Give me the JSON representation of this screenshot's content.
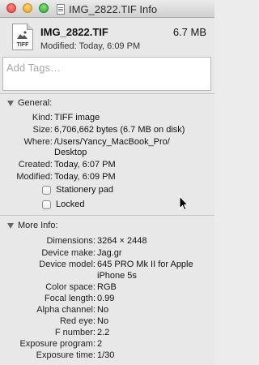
{
  "window": {
    "title": "IMG_2822.TIF Info"
  },
  "header": {
    "filename": "IMG_2822.TIF",
    "size": "6.7 MB",
    "modified": "Modified: Today, 6:09 PM",
    "file_icon_ext": "TIFF"
  },
  "tags": {
    "placeholder": "Add Tags…"
  },
  "general": {
    "title": "General:",
    "rows": [
      {
        "k": "Kind:",
        "v": "TIFF image"
      },
      {
        "k": "Size:",
        "v": "6,706,662 bytes (6.7 MB on disk)"
      },
      {
        "k": "Where:",
        "v": "/Users/Yancy_MacBook_Pro/"
      },
      {
        "k": "",
        "v": "Desktop"
      },
      {
        "k": "Created:",
        "v": "Today, 6:07 PM"
      },
      {
        "k": "Modified:",
        "v": "Today, 6:09 PM"
      }
    ],
    "stationery_label": "Stationery pad",
    "locked_label": "Locked",
    "stationery_checked": false,
    "locked_checked": false
  },
  "more_info": {
    "title": "More Info:",
    "rows": [
      {
        "k": "Dimensions:",
        "v": "3264 × 2448"
      },
      {
        "k": "Device make:",
        "v": "Jag.gr"
      },
      {
        "k": "Device model:",
        "v": "645 PRO Mk II for Apple"
      },
      {
        "k": "",
        "v": "iPhone 5s"
      },
      {
        "k": "Color space:",
        "v": "RGB"
      },
      {
        "k": "Focal length:",
        "v": "0.99"
      },
      {
        "k": "Alpha channel:",
        "v": "No"
      },
      {
        "k": "Red eye:",
        "v": "No"
      },
      {
        "k": "F number:",
        "v": "2.2"
      },
      {
        "k": "Exposure program:",
        "v": "2"
      },
      {
        "k": "Exposure time:",
        "v": "1/30"
      }
    ]
  }
}
